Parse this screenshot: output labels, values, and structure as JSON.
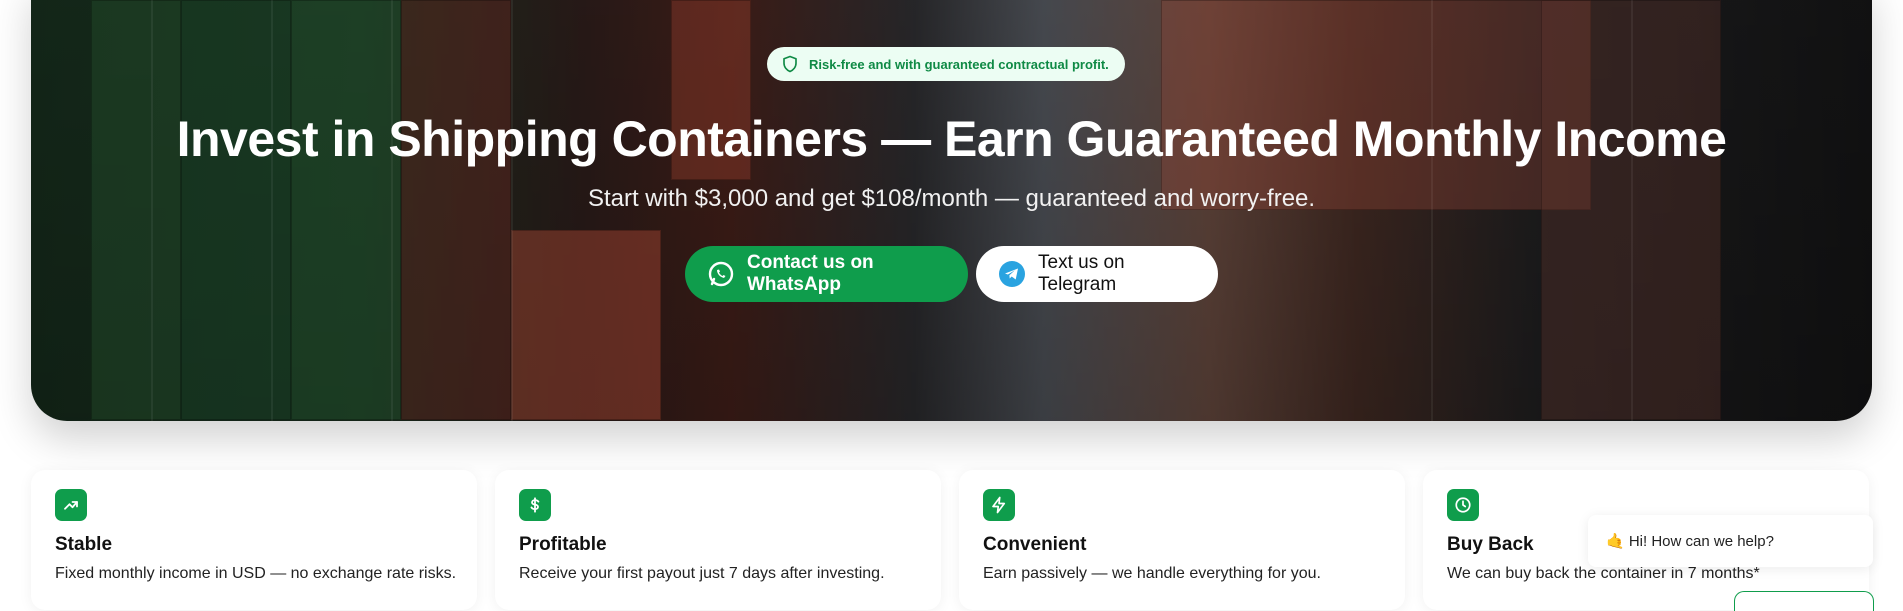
{
  "hero": {
    "badge_text": "Risk-free and with guaranteed contractual profit.",
    "title": "Invest in Shipping Containers — Earn Guaranteed Monthly Income",
    "subtitle": "Start with $3,000 and get $108/month — guaranteed and worry-free.",
    "whatsapp_label": "Contact us on WhatsApp",
    "telegram_label": "Text us on Telegram"
  },
  "features": [
    {
      "icon": "trending-up-icon",
      "title": "Stable",
      "text": "Fixed monthly income in USD — no exchange rate risks."
    },
    {
      "icon": "dollar-icon",
      "title": "Profitable",
      "text": "Receive your first payout just 7 days after investing."
    },
    {
      "icon": "lightning-icon",
      "title": "Convenient",
      "text": "Earn passively — we handle everything for you."
    },
    {
      "icon": "clock-icon",
      "title": "Buy Back",
      "text": "We can buy back the container in 7 months*"
    }
  ],
  "chat": {
    "greeting": "🤙 Hi! How can we help?"
  },
  "colors": {
    "accent": "#0f9d4c",
    "badge_bg": "#ecfdf3",
    "telegram": "#2aa3e0"
  }
}
